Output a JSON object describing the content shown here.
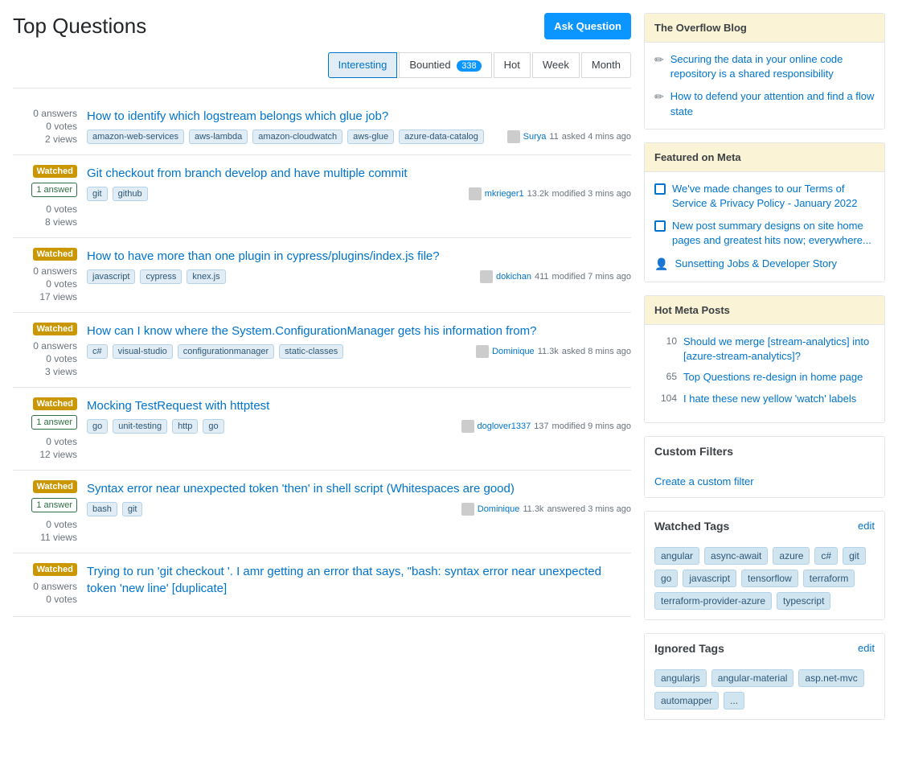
{
  "page": {
    "title": "Top Questions",
    "askButton": "Ask Question"
  },
  "filters": {
    "tabs": [
      {
        "id": "interesting",
        "label": "Interesting",
        "active": true,
        "badge": null
      },
      {
        "id": "bountied",
        "label": "Bountied",
        "active": false,
        "badge": "338"
      },
      {
        "id": "hot",
        "label": "Hot",
        "active": false,
        "badge": null
      },
      {
        "id": "week",
        "label": "Week",
        "active": false,
        "badge": null
      },
      {
        "id": "month",
        "label": "Month",
        "active": false,
        "badge": null
      }
    ]
  },
  "questions": [
    {
      "id": 1,
      "watched": false,
      "answers": 0,
      "answersLabel": "0 answers",
      "votes": "0 votes",
      "views": "2 views",
      "hasAnswerBadge": false,
      "title": "How to identify which logstream belongs which glue job?",
      "tags": [
        "amazon-web-services",
        "aws-lambda",
        "amazon-cloudwatch",
        "aws-glue",
        "azure-data-catalog"
      ],
      "user": "Surya",
      "userRep": "11",
      "action": "asked",
      "time": "4 mins ago"
    },
    {
      "id": 2,
      "watched": true,
      "answers": 1,
      "answersLabel": "1 answer",
      "votes": "0 votes",
      "views": "8 views",
      "hasAnswerBadge": true,
      "title": "Git checkout from branch develop and have multiple commit",
      "tags": [
        "git",
        "github"
      ],
      "user": "mkrieger1",
      "userRep": "13.2k",
      "action": "modified",
      "time": "3 mins ago"
    },
    {
      "id": 3,
      "watched": true,
      "answers": 0,
      "answersLabel": "0 answers",
      "votes": "0 votes",
      "views": "17 views",
      "hasAnswerBadge": false,
      "title": "How to have more than one plugin in cypress/plugins/index.js file?",
      "tags": [
        "javascript",
        "cypress",
        "knex.js"
      ],
      "user": "dokichan",
      "userRep": "411",
      "action": "modified",
      "time": "7 mins ago"
    },
    {
      "id": 4,
      "watched": true,
      "answers": 0,
      "answersLabel": "0 answers",
      "votes": "0 votes",
      "views": "3 views",
      "hasAnswerBadge": false,
      "title": "How can I know where the System.ConfigurationManager gets his information from?",
      "tags": [
        "c#",
        "visual-studio",
        "configurationmanager",
        "static-classes"
      ],
      "user": "Dominique",
      "userRep": "11.3k",
      "action": "asked",
      "time": "8 mins ago"
    },
    {
      "id": 5,
      "watched": true,
      "answers": 1,
      "answersLabel": "1 answer",
      "votes": "0 votes",
      "views": "12 views",
      "hasAnswerBadge": true,
      "title": "Mocking TestRequest with httptest",
      "tags": [
        "go",
        "unit-testing",
        "http",
        "go"
      ],
      "user": "doglover1337",
      "userRep": "137",
      "action": "modified",
      "time": "9 mins ago"
    },
    {
      "id": 6,
      "watched": true,
      "answers": 1,
      "answersLabel": "1 answer",
      "votes": "0 votes",
      "views": "11 views",
      "hasAnswerBadge": true,
      "title": "Syntax error near unexpected token 'then' in shell script (Whitespaces are good)",
      "tags": [
        "bash",
        "git"
      ],
      "user": "Dominique",
      "userRep": "11.3k",
      "action": "answered",
      "time": "3 mins ago"
    },
    {
      "id": 7,
      "watched": true,
      "answers": 0,
      "answersLabel": "0 answers",
      "votes": "0 votes",
      "views": "",
      "hasAnswerBadge": false,
      "title": "Trying to run 'git checkout <hash>'. I amr getting an error that says, \"bash: syntax error near unexpected token 'new line' [duplicate]",
      "tags": [],
      "user": "",
      "userRep": "",
      "action": "",
      "time": ""
    }
  ],
  "sidebar": {
    "overflowBlog": {
      "title": "The Overflow Blog",
      "items": [
        "Securing the data in your online code repository is a shared responsibility",
        "How to defend your attention and find a flow state"
      ]
    },
    "featuredOnMeta": {
      "title": "Featured on Meta",
      "items": [
        {
          "type": "square",
          "text": "We've made changes to our Terms of Service & Privacy Policy - January 2022"
        },
        {
          "type": "square",
          "text": "New post summary designs on site home pages and greatest hits now; everywhere..."
        },
        {
          "type": "person",
          "text": "Sunsetting Jobs & Developer Story"
        }
      ]
    },
    "hotMetaPosts": {
      "title": "Hot Meta Posts",
      "items": [
        {
          "number": "10",
          "text": "Should we merge [stream-analytics] into [azure-stream-analytics]?"
        },
        {
          "number": "65",
          "text": "Top Questions re-design in home page"
        },
        {
          "number": "104",
          "text": "I hate these new yellow 'watch' labels"
        }
      ]
    },
    "customFilters": {
      "title": "Custom Filters",
      "createLink": "Create a custom filter"
    },
    "watchedTags": {
      "title": "Watched Tags",
      "editLabel": "edit",
      "tags": [
        "angular",
        "async-await",
        "azure",
        "c#",
        "git",
        "go",
        "javascript",
        "tensorflow",
        "terraform",
        "terraform-provider-azure",
        "typescript"
      ]
    },
    "ignoredTags": {
      "title": "Ignored Tags",
      "editLabel": "edit",
      "tags": [
        "angularjs",
        "angular-material",
        "asp.net-mvc",
        "automapper",
        "..."
      ]
    }
  }
}
